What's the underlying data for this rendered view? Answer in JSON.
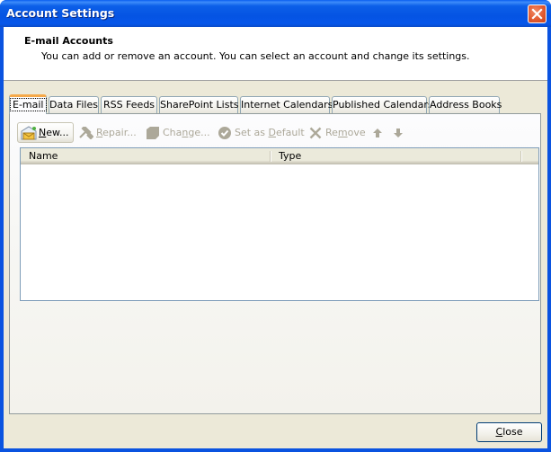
{
  "window": {
    "title": "Account Settings",
    "close_label": "Close window"
  },
  "header": {
    "title": "E-mail Accounts",
    "description": "You can add or remove an account. You can select an account and change its settings."
  },
  "tabs": [
    {
      "label": "E-mail",
      "active": true
    },
    {
      "label": "Data Files",
      "active": false
    },
    {
      "label": "RSS Feeds",
      "active": false
    },
    {
      "label": "SharePoint Lists",
      "active": false
    },
    {
      "label": "Internet Calendars",
      "active": false
    },
    {
      "label": "Published Calendars",
      "active": false
    },
    {
      "label": "Address Books",
      "active": false
    }
  ],
  "toolbar": {
    "new": {
      "pre": "",
      "mnemonic": "N",
      "post": "ew...",
      "icon": "new-account-envelope-icon",
      "enabled": true
    },
    "repair": {
      "pre": "",
      "mnemonic": "R",
      "post": "epair...",
      "icon": "tools-icon",
      "enabled": false
    },
    "change": {
      "pre": "Cha",
      "mnemonic": "n",
      "post": "ge...",
      "icon": "change-icon",
      "enabled": false
    },
    "set_default": {
      "pre": "Set as ",
      "mnemonic": "D",
      "post": "efault",
      "icon": "checkmark-circle-icon",
      "enabled": false
    },
    "remove": {
      "pre": "Re",
      "mnemonic": "m",
      "post": "ove",
      "icon": "x-icon",
      "enabled": false
    },
    "move_up": {
      "icon": "arrow-up-icon",
      "enabled": false
    },
    "move_down": {
      "icon": "arrow-down-icon",
      "enabled": false
    }
  },
  "accounts_list": {
    "columns": [
      "Name",
      "Type"
    ],
    "rows": []
  },
  "footer": {
    "close": {
      "mnemonic": "C",
      "post": "lose"
    }
  },
  "colors": {
    "titlebar": "#0554e3",
    "dialog_bg": "#ece9d8",
    "active_tab_accent": "#f5a94a",
    "disabled_text": "#aca899"
  }
}
